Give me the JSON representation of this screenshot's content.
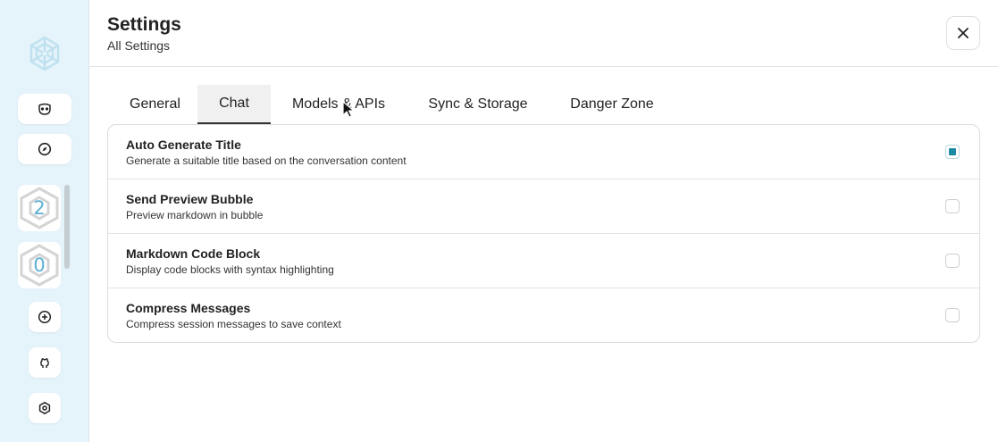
{
  "colors": {
    "sidebar_bg": "#e5f3fa",
    "accent": "#1a8aa2",
    "session_number": "#5bb0d3"
  },
  "sidebar": {
    "logo_icon": "openai-logo-icon",
    "buttons": [
      {
        "icon": "mask-icon"
      },
      {
        "icon": "compass-icon"
      }
    ],
    "sessions": [
      {
        "count": "2"
      },
      {
        "count": "0"
      }
    ],
    "bottom_buttons": [
      {
        "icon": "add-icon"
      },
      {
        "icon": "github-icon"
      },
      {
        "icon": "settings-icon"
      }
    ]
  },
  "header": {
    "title": "Settings",
    "subtitle": "All Settings",
    "close_icon": "close-icon"
  },
  "tabs": [
    {
      "label": "General",
      "active": false
    },
    {
      "label": "Chat",
      "active": true
    },
    {
      "label": "Models & APIs",
      "active": false
    },
    {
      "label": "Sync & Storage",
      "active": false
    },
    {
      "label": "Danger Zone",
      "active": false
    }
  ],
  "settings": [
    {
      "title": "Auto Generate Title",
      "description": "Generate a suitable title based on the conversation content",
      "checked": true
    },
    {
      "title": "Send Preview Bubble",
      "description": "Preview markdown in bubble",
      "checked": false
    },
    {
      "title": "Markdown Code Block",
      "description": "Display code blocks with syntax highlighting",
      "checked": false
    },
    {
      "title": "Compress Messages",
      "description": "Compress session messages to save context",
      "checked": false
    }
  ]
}
